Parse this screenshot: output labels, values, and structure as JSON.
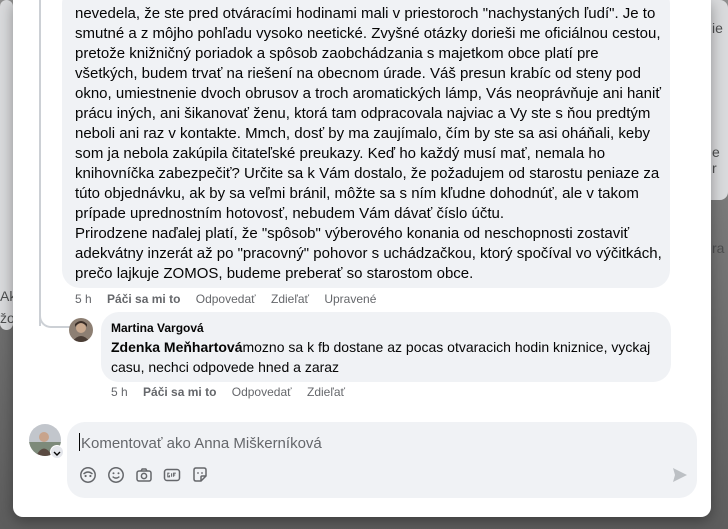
{
  "background": {
    "fragments": [
      "ie",
      "e r",
      "ra",
      "Ak",
      "žo"
    ]
  },
  "comment": {
    "lines": [
      "nevedela, že ste pred otváracími hodinami mali v priestoroch \"nachystaných ľudí\". Je to",
      "smutné a z môjho pohľadu vysoko neetické. Zvyšné otázky dorieši me oficiálnou cestou,",
      "pretože knižničný poriadok a spôsob zaobchádzania s majetkom obce platí pre",
      "všetkých, budem trvať na riešení na obecnom úrade. Váš presun krabíc od steny pod",
      "okno, umiestnenie dvoch obrusov a troch aromatických lámp, Vás neoprávňuje ani haniť",
      "prácu iných, ani šikanovať ženu, ktorá tam odpracovala najviac a Vy ste s ňou predtým",
      "neboli ani raz v kontakte. Mmch, dosť by ma zaujímalo, čím by ste sa asi oháňali, keby",
      "som ja nebola zakúpila čitateľské preukazy. Keď ho každý musí mať, nemala ho",
      "knihovníčka zabezpečiť? Určite sa k Vám dostalo, že požadujem od starostu peniaze za",
      "túto objednávku, ak by sa veľmi bránil, môžte sa s ním kľudne dohodnúť, ale v takom",
      "prípade uprednostním hotovosť, nebudem Vám dávať číslo účtu.",
      "Prirodzene naďalej platí, že \"spôsob\" výberového konania od neschopnosti zostaviť",
      "adekvátny inzerát až po \"pracovný\" pohovor s uchádzačkou, ktorý spočíval vo výčitkách,",
      "prečo lajkuje ZOMOS, budeme preberať so starostom obce."
    ],
    "actions": {
      "time": "5 h",
      "like": "Páči sa mi to",
      "reply": "Odpovedať",
      "share": "Zdieľať",
      "edited": "Upravené"
    }
  },
  "reply": {
    "author": "Martina Vargová",
    "mention": "Zdenka Meňhartová",
    "text": "mozno sa k fb dostane az pocas otvaracich hodin kniznice, vyckaj casu, nechci odpovede hned a zaraz",
    "actions": {
      "time": "5 h",
      "like": "Páči sa mi to",
      "reply": "Odpovedať",
      "share": "Zdieľať"
    }
  },
  "composer": {
    "placeholder": "Komentovať ako Anna Miškerníková",
    "tools": [
      "avatar-sticker-icon",
      "emoji-icon",
      "camera-icon",
      "gif-icon",
      "sticker-icon"
    ]
  },
  "colors": {
    "bubble": "#f0f2f5",
    "meta": "#65676b",
    "text": "#050505"
  }
}
